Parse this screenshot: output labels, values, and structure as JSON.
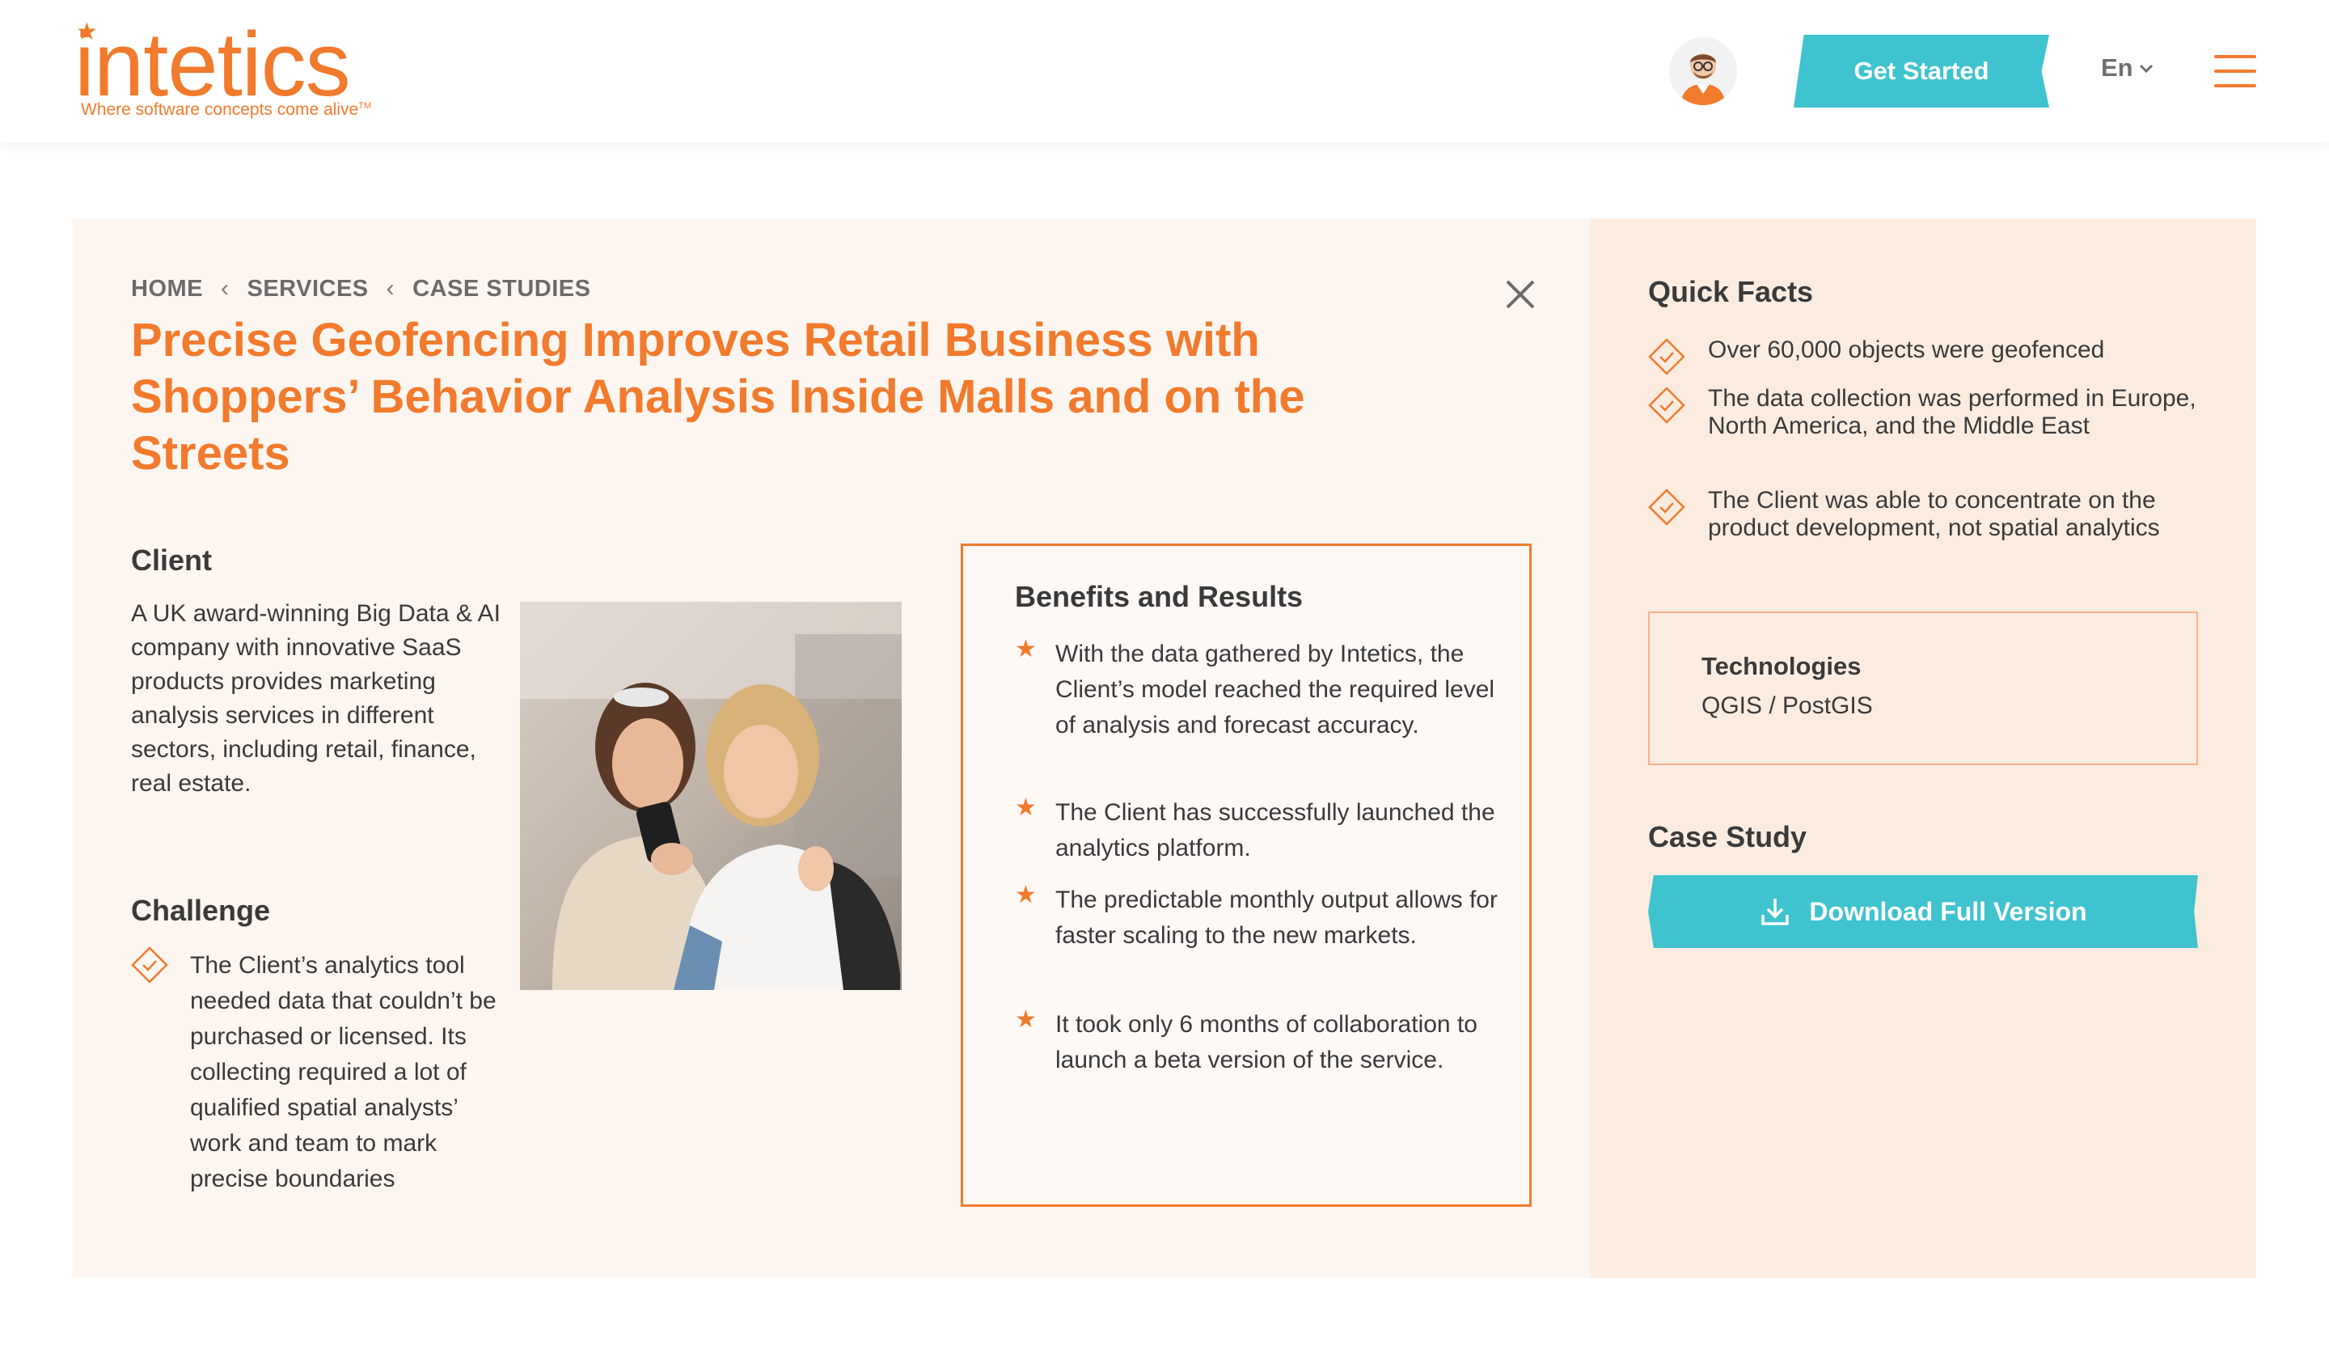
{
  "header": {
    "logo_text": "intetics",
    "logo_tagline": "Where software concepts come alive",
    "logo_tm": "TM",
    "cta_label": "Get Started",
    "language": "En"
  },
  "breadcrumb": [
    "HOME",
    "SERVICES",
    "CASE STUDIES"
  ],
  "title": "Precise Geofencing Improves Retail Business with Shoppers’ Behavior Analysis Inside Malls and on the Streets",
  "client": {
    "heading": "Client",
    "text": "A UK award-winning Big Data & AI company with innovative SaaS products provides marketing analysis services in different sectors, including retail, finance, real estate."
  },
  "challenge": {
    "heading": "Challenge",
    "text": "The Client’s analytics tool needed data that couldn’t be purchased or licensed. Its collecting required a lot of qualified spatial analysts’ work and team to mark precise boundaries"
  },
  "benefits": {
    "heading": "Benefits and Results",
    "items": [
      "With the data gathered by Intetics, the Client’s model reached the required level of analysis and forecast accuracy.",
      "The Client has successfully launched the analytics platform.",
      "The predictable monthly output allows for faster scaling to the new markets.",
      "It took only 6 months of collaboration to launch a beta version of the service."
    ]
  },
  "quick_facts": {
    "heading": "Quick Facts",
    "items": [
      "Over 60,000 objects were geofenced",
      "The data collection was performed in Europe, North America, and the Middle East",
      "The Client was able to concentrate on the product development, not spatial analytics"
    ]
  },
  "technologies": {
    "heading": "Technologies",
    "value": "QGIS / PostGIS"
  },
  "case_study": {
    "heading": "Case Study",
    "download_label": "Download Full Version"
  },
  "colors": {
    "brand_orange": "#f27a2d",
    "accent_teal": "#3fc3cf",
    "card_bg": "#fdf6f0",
    "sidebar_bg": "#fcece0"
  }
}
